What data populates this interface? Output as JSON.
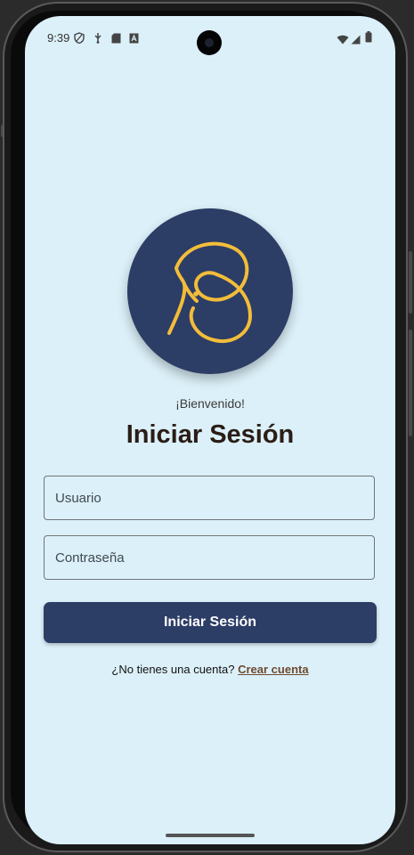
{
  "status_bar": {
    "time": "9:39",
    "icons_left": [
      "shield-icon",
      "usb-debug-icon",
      "sd-card-icon",
      "a-box-icon"
    ],
    "icons_right": [
      "wifi-icon",
      "signal-icon",
      "battery-icon"
    ]
  },
  "login": {
    "welcome": "¡Bienvenido!",
    "title": "Iniciar Sesión",
    "username_placeholder": "Usuario",
    "password_placeholder": "Contraseña",
    "submit_label": "Iniciar Sesión",
    "signup_prompt": "¿No tienes una cuenta?",
    "signup_link": "Crear cuenta"
  },
  "colors": {
    "background": "#dcf0f9",
    "primary": "#2c3d66",
    "logo_stroke": "#f2bd3a",
    "link": "#6e4a2f"
  }
}
